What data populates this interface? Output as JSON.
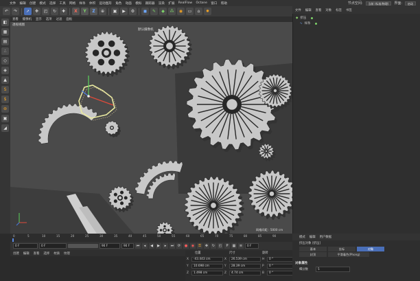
{
  "menubar": {
    "items": [
      "文件",
      "编辑",
      "创建",
      "模式",
      "选择",
      "工具",
      "网格",
      "样条",
      "体积",
      "运动图形",
      "角色",
      "动画",
      "模拟",
      "跟踪器",
      "渲染",
      "扩展",
      "RealFlow",
      "Octane",
      "窗口",
      "帮助"
    ],
    "right_label": "节点空间:",
    "node_space": "当前 (标准/物理)",
    "layout_label": "界面:",
    "layout_value": "启动"
  },
  "toolbar": {
    "undo": "↶",
    "axis_x": "X",
    "axis_y": "Y",
    "axis_z": "Z"
  },
  "viewport": {
    "menu": [
      "查看",
      "摄像机",
      "显示",
      "选项",
      "过滤",
      "面板"
    ],
    "label": "透视视图",
    "camera_label": "默认摄像机",
    "grid_text": "网格间距 : 5000 cm",
    "colors": {
      "background": "#4a4a4a",
      "gear": "#c8c8c8",
      "gear_dark": "#262626",
      "shadow": "#333333"
    }
  },
  "timeline": {
    "ticks": [
      "0",
      "5",
      "10",
      "15",
      "20",
      "25",
      "30",
      "35",
      "40",
      "45",
      "50",
      "55",
      "60",
      "65",
      "70",
      "75",
      "80",
      "85",
      "90"
    ],
    "current_frame": "0 F",
    "start": "0 F",
    "end": "90 F",
    "max": "90 F",
    "end_readout": "0 F"
  },
  "materials": {
    "menu": [
      "创建",
      "编辑",
      "查看",
      "选择",
      "材质",
      "纹理"
    ]
  },
  "coordinates": {
    "headers": [
      "位置",
      "尺寸",
      "旋转"
    ],
    "rows": [
      {
        "axis": "X",
        "pos": "-43.443 cm",
        "size_axis": "X",
        "size": "26.539 cm",
        "rot_axis": "H",
        "rot": "0 °"
      },
      {
        "axis": "Y",
        "pos": "10.698 cm",
        "size_axis": "Y",
        "size": "28.39 cm",
        "rot_axis": "P",
        "rot": "0 °"
      },
      {
        "axis": "Z",
        "pos": "1.498 cm",
        "size_axis": "Z",
        "size": "4.74 cm",
        "rot_axis": "B",
        "rot": "0 °"
      }
    ]
  },
  "objects": {
    "menu": [
      "文件",
      "编辑",
      "查看",
      "对象",
      "标签",
      "书签"
    ],
    "items": [
      "挤压",
      "样条"
    ]
  },
  "attributes": {
    "menu": [
      "模式",
      "编辑",
      "用户数据"
    ],
    "object_title": "挤压对象 [挤压]",
    "tabs": [
      "基本",
      "坐标",
      "对象",
      "封顶",
      "平滑着色(Phong)"
    ],
    "section": "对象属性",
    "subdivision_label": "细分数",
    "subdivision_value": "5"
  }
}
